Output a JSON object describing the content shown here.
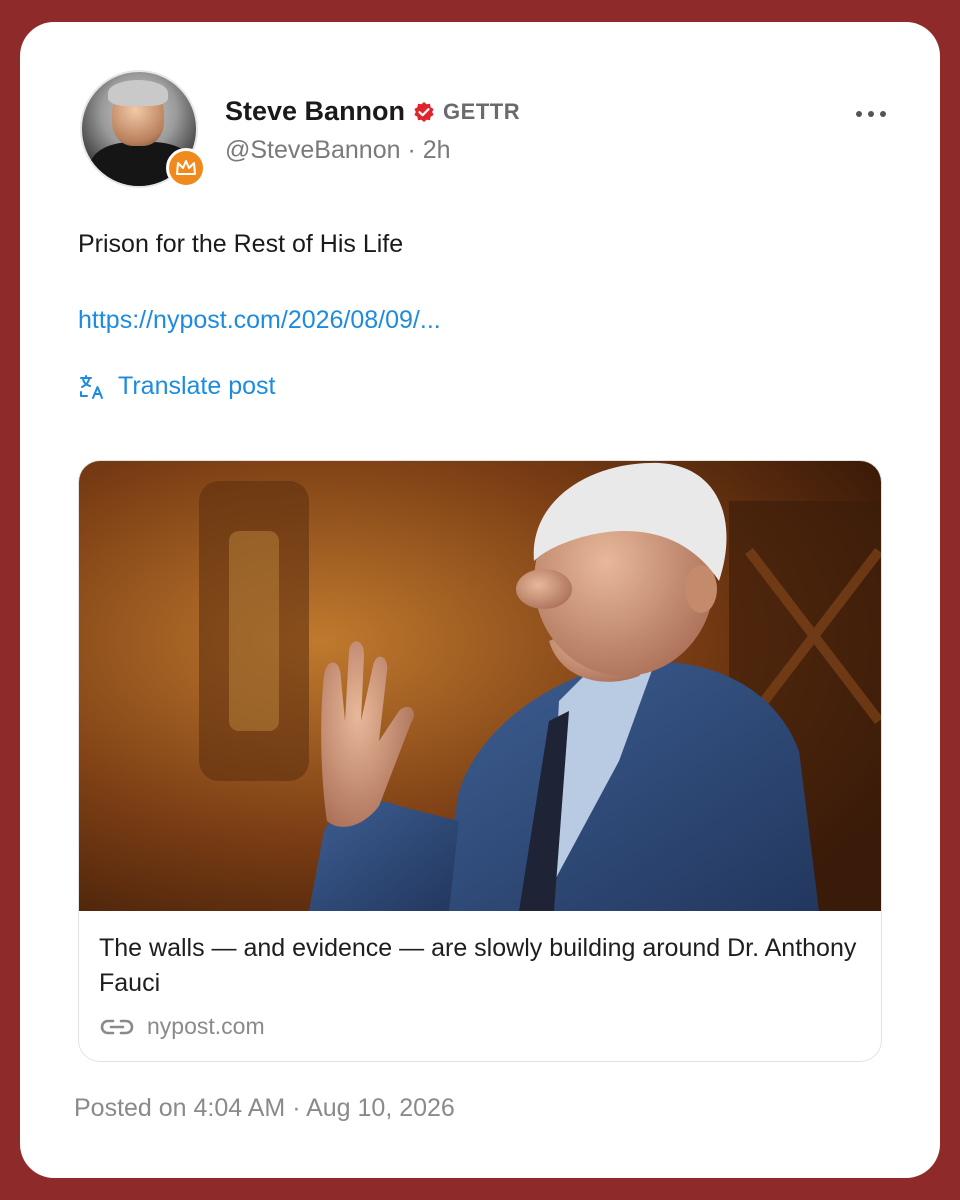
{
  "post": {
    "author_name": "Steve Bannon",
    "platform": "GETTR",
    "handle_time": "@SteveBannon · 2h",
    "text": "Prison for the Rest of His Life",
    "link": "https://nypost.com/2026/08/09/...",
    "translate_label": "Translate post",
    "posted_on": "Posted on 4:04 AM · Aug 10, 2026"
  },
  "preview": {
    "title": "The walls — and evidence — are slowly building around Dr. Anthony Fauci",
    "source": "nypost.com"
  },
  "icons": {
    "verified": "verified-badge-icon",
    "crown": "crown-icon",
    "more": "more-options-icon",
    "translate": "translate-icon",
    "link": "link-icon"
  },
  "colors": {
    "background": "#8f2a2a",
    "card": "#ffffff",
    "link": "#1d8ce0",
    "verified": "#e0242c",
    "crown_badge": "#f08a1d",
    "muted_text": "#8a8a8a"
  }
}
